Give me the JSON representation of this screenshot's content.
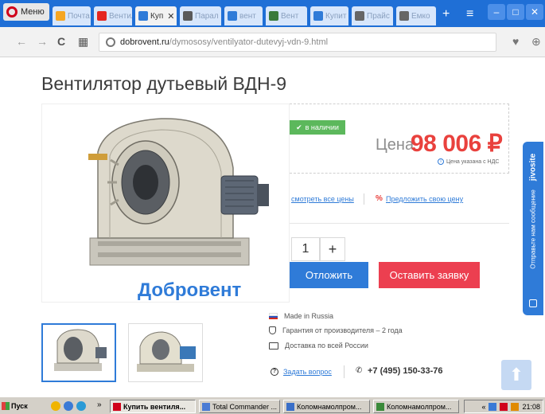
{
  "browser": {
    "menu_label": "Меню",
    "tabs": [
      {
        "label": "Почта",
        "icon": "mail-icon",
        "color": "#f5a623"
      },
      {
        "label": "Вентил",
        "icon": "yandex-icon",
        "color": "#e52620"
      },
      {
        "label": "Куп",
        "icon": "site-icon",
        "color": "#2f7bd8",
        "active": true
      },
      {
        "label": "Парал",
        "icon": "gear-icon",
        "color": "#5a5a5a"
      },
      {
        "label": "вент",
        "icon": "cart-icon",
        "color": "#2f7bd8"
      },
      {
        "label": "Вент",
        "icon": "fan-icon",
        "color": "#3a7a3a"
      },
      {
        "label": "Купит",
        "icon": "site-icon",
        "color": "#2f7bd8"
      },
      {
        "label": "Прайс",
        "icon": "doc-icon",
        "color": "#666666"
      },
      {
        "label": "Емко",
        "icon": "doc-icon",
        "color": "#666666"
      }
    ],
    "new_tab": "+",
    "url_host": "dobrovent.ru",
    "url_path": "/dymososy/ventilyator-dutevyj-vdn-9.html"
  },
  "product": {
    "title": "Вентилятор дутьевый ВДН-9",
    "stock": "в наличии",
    "price_label": "Цена",
    "price_value": "98 006 ₽",
    "vat_note": "Цена указана с НДС",
    "all_prices_link": "смотреть все цены",
    "offer_link": "Предложить свою цену",
    "qty_value": "1",
    "qty_plus": "+",
    "defer_btn": "Отложить",
    "request_btn": "Оставить заявку",
    "features": [
      "Made in Russia",
      "Гарантия от производителя – 2 года",
      "Доставка по всей России"
    ],
    "ask_link": "Задать вопрос",
    "phone": "+7 (495) 150-33-76",
    "watermark": "Добровент"
  },
  "side_widget": {
    "brand": "jivosite",
    "text": "Отправьте нам сообщение"
  },
  "taskbar": {
    "start": "Пуск",
    "overflow": "»",
    "tasks": [
      {
        "label": "Купить вентиля...",
        "active": true,
        "color": "#d0021b"
      },
      {
        "label": "Total Commander ...",
        "active": false,
        "color": "#4a7bd4"
      },
      {
        "label": "Коломнамолпром...",
        "active": false,
        "color": "#3a6fc8"
      },
      {
        "label": "Коломнамолпром...",
        "active": false,
        "color": "#3a8a3a"
      }
    ],
    "tray_overflow": "«",
    "clock": "21:08"
  }
}
